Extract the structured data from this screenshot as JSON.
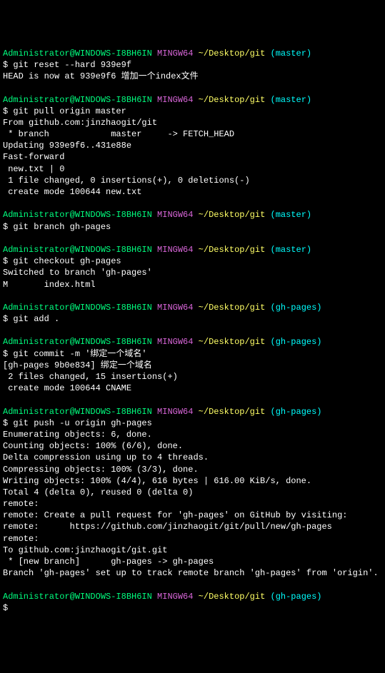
{
  "blocks": [
    {
      "prompt": {
        "user": "Administrator@WINDOWS-I8BH6IN",
        "mingw": "MINGW64",
        "path": "~/Desktop/git",
        "branch": "(master)"
      },
      "lines": [
        "$ git reset --hard 939e9f",
        "HEAD is now at 939e9f6 增加一个index文件"
      ]
    },
    {
      "prompt": {
        "user": "Administrator@WINDOWS-I8BH6IN",
        "mingw": "MINGW64",
        "path": "~/Desktop/git",
        "branch": "(master)"
      },
      "lines": [
        "$ git pull origin master",
        "From github.com:jinzhaogit/git",
        " * branch            master     -> FETCH_HEAD",
        "Updating 939e9f6..431e88e",
        "Fast-forward",
        " new.txt | 0",
        " 1 file changed, 0 insertions(+), 0 deletions(-)",
        " create mode 100644 new.txt"
      ]
    },
    {
      "prompt": {
        "user": "Administrator@WINDOWS-I8BH6IN",
        "mingw": "MINGW64",
        "path": "~/Desktop/git",
        "branch": "(master)"
      },
      "lines": [
        "$ git branch gh-pages"
      ]
    },
    {
      "prompt": {
        "user": "Administrator@WINDOWS-I8BH6IN",
        "mingw": "MINGW64",
        "path": "~/Desktop/git",
        "branch": "(master)"
      },
      "lines": [
        "$ git checkout gh-pages",
        "Switched to branch 'gh-pages'",
        "M       index.html"
      ]
    },
    {
      "prompt": {
        "user": "Administrator@WINDOWS-I8BH6IN",
        "mingw": "MINGW64",
        "path": "~/Desktop/git",
        "branch": "(gh-pages)"
      },
      "lines": [
        "$ git add ."
      ]
    },
    {
      "prompt": {
        "user": "Administrator@WINDOWS-I8BH6IN",
        "mingw": "MINGW64",
        "path": "~/Desktop/git",
        "branch": "(gh-pages)"
      },
      "lines": [
        "$ git commit -m '绑定一个域名'",
        "[gh-pages 9b0e834] 绑定一个域名",
        " 2 files changed, 15 insertions(+)",
        " create mode 100644 CNAME"
      ]
    },
    {
      "prompt": {
        "user": "Administrator@WINDOWS-I8BH6IN",
        "mingw": "MINGW64",
        "path": "~/Desktop/git",
        "branch": "(gh-pages)"
      },
      "lines": [
        "$ git push -u origin gh-pages",
        "Enumerating objects: 6, done.",
        "Counting objects: 100% (6/6), done.",
        "Delta compression using up to 4 threads.",
        "Compressing objects: 100% (3/3), done.",
        "Writing objects: 100% (4/4), 616 bytes | 616.00 KiB/s, done.",
        "Total 4 (delta 0), reused 0 (delta 0)",
        "remote:",
        "remote: Create a pull request for 'gh-pages' on GitHub by visiting:",
        "remote:      https://github.com/jinzhaogit/git/pull/new/gh-pages",
        "remote:",
        "To github.com:jinzhaogit/git.git",
        " * [new branch]      gh-pages -> gh-pages",
        "Branch 'gh-pages' set up to track remote branch 'gh-pages' from 'origin'."
      ]
    },
    {
      "prompt": {
        "user": "Administrator@WINDOWS-I8BH6IN",
        "mingw": "MINGW64",
        "path": "~/Desktop/git",
        "branch": "(gh-pages)"
      },
      "lines": [
        "$"
      ]
    }
  ]
}
